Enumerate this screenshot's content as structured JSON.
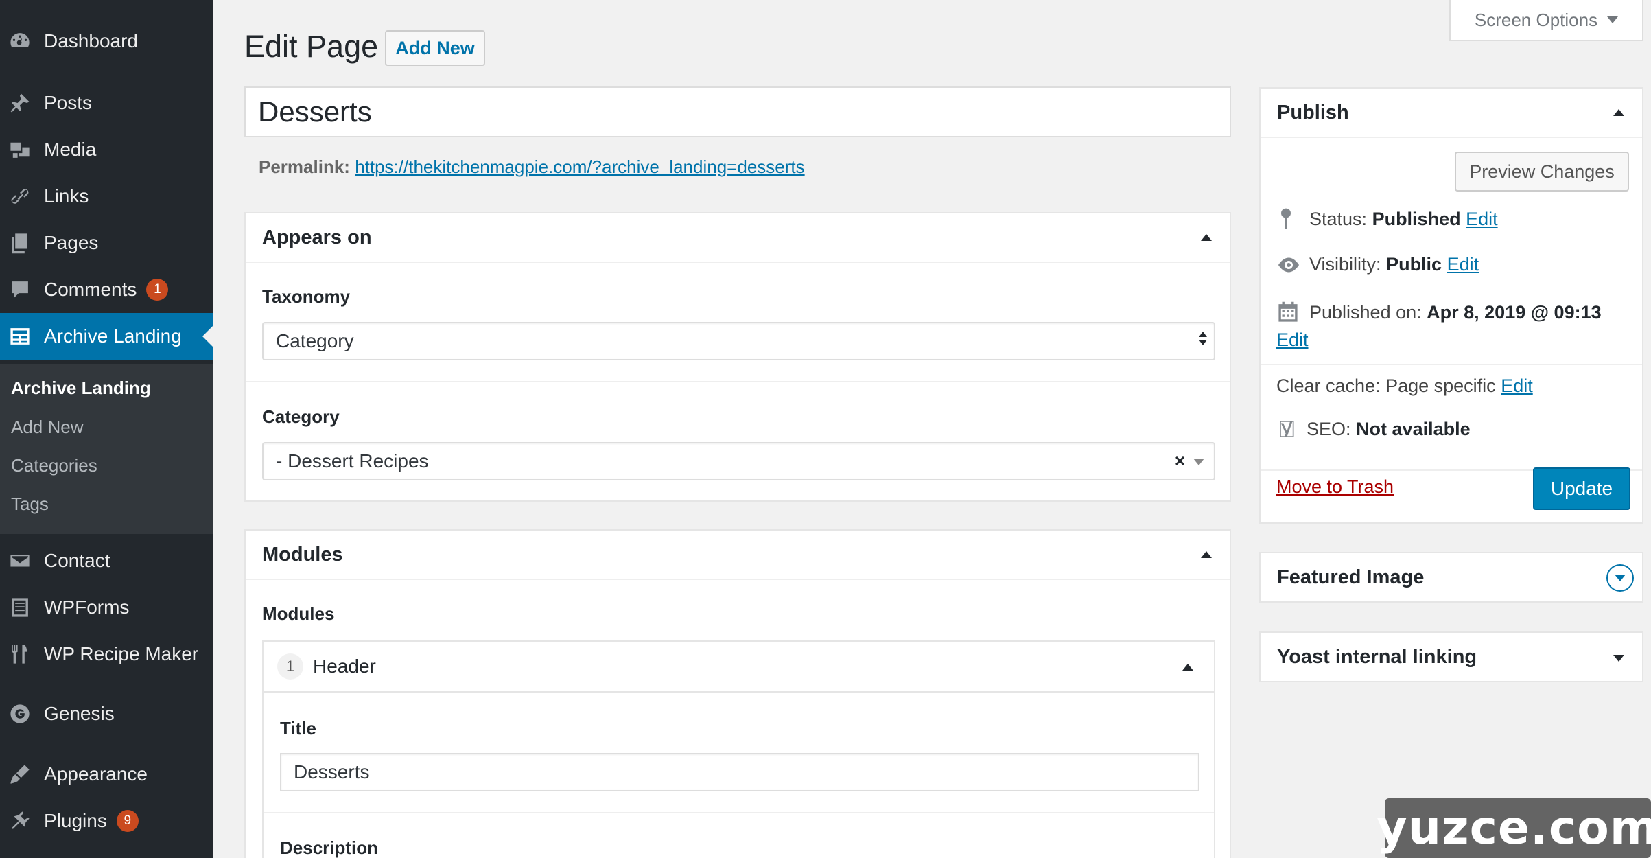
{
  "sidebar": {
    "items": [
      {
        "label": "Dashboard",
        "icon": "dashboard-icon"
      },
      {
        "label": "Posts",
        "icon": "pin-icon"
      },
      {
        "label": "Media",
        "icon": "media-icon"
      },
      {
        "label": "Links",
        "icon": "link-icon"
      },
      {
        "label": "Pages",
        "icon": "pages-icon"
      },
      {
        "label": "Comments",
        "icon": "comment-icon",
        "badge": "1"
      },
      {
        "label": "Archive Landing",
        "icon": "table-icon",
        "current": true
      },
      {
        "label": "Contact",
        "icon": "envelope-icon"
      },
      {
        "label": "WPForms",
        "icon": "form-icon"
      },
      {
        "label": "WP Recipe Maker",
        "icon": "fork-knife-icon"
      },
      {
        "label": "Genesis",
        "icon": "genesis-icon"
      },
      {
        "label": "Appearance",
        "icon": "brush-icon"
      },
      {
        "label": "Plugins",
        "icon": "plug-icon",
        "badge": "9"
      }
    ],
    "submenu": [
      "Archive Landing",
      "Add New",
      "Categories",
      "Tags"
    ]
  },
  "header": {
    "title": "Edit Page",
    "add_new": "Add New",
    "screen_options": "Screen Options"
  },
  "post": {
    "title": "Desserts",
    "permalink_label": "Permalink:",
    "permalink_url": "https://thekitchenmagpie.com/?archive_landing=desserts"
  },
  "appears_on": {
    "heading": "Appears on",
    "taxonomy_label": "Taxonomy",
    "taxonomy_value": "Category",
    "category_label": "Category",
    "category_value": "- Dessert Recipes",
    "clear_symbol": "×"
  },
  "modules": {
    "heading": "Modules",
    "label": "Modules",
    "module_index": "1",
    "module_name": "Header",
    "title_label": "Title",
    "title_value": "Desserts",
    "description_label": "Description"
  },
  "publish": {
    "heading": "Publish",
    "preview": "Preview Changes",
    "status_label": "Status:",
    "status_value": "Published",
    "visibility_label": "Visibility:",
    "visibility_value": "Public",
    "published_label": "Published on:",
    "published_value": "Apr 8, 2019 @ 09:13",
    "edit": "Edit",
    "cache_label": "Clear cache: Page specific",
    "seo_label": "SEO:",
    "seo_value": "Not available",
    "trash": "Move to Trash",
    "update": "Update"
  },
  "featured_image": {
    "heading": "Featured Image"
  },
  "yoast": {
    "heading": "Yoast internal linking"
  },
  "watermark": "yuzce.com",
  "colors": {
    "sidebar": "#23282d",
    "accent": "#0073aa",
    "badge": "#ca4a1f",
    "trash": "#a00"
  }
}
